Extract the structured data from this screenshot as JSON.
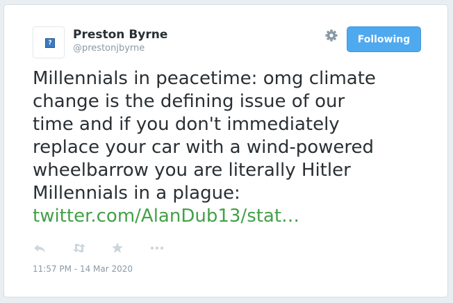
{
  "tweet": {
    "author": {
      "name": "Preston Byrne",
      "handle": "@prestonjbyrne",
      "avatar_placeholder": "?"
    },
    "follow_button_label": "Following",
    "text_lines": [
      "Millennials in peacetime: omg climate",
      "change is the defining issue of our",
      "time and if you don't immediately",
      "replace your car with a wind-powered",
      "wheelbarrow you are literally Hitler",
      "Millennials in a plague:"
    ],
    "link_text": "twitter.com/AlanDub13/stat…",
    "timestamp": "11:57 PM - 14 Mar 2020",
    "icons": [
      "gear-icon",
      "reply-icon",
      "retweet-icon",
      "favorite-icon",
      "more-icon"
    ],
    "colors": {
      "button_bg": "#4fa9ef",
      "link": "#43a047",
      "icon": "#ccd6dd",
      "gear": "#8899a6"
    }
  }
}
